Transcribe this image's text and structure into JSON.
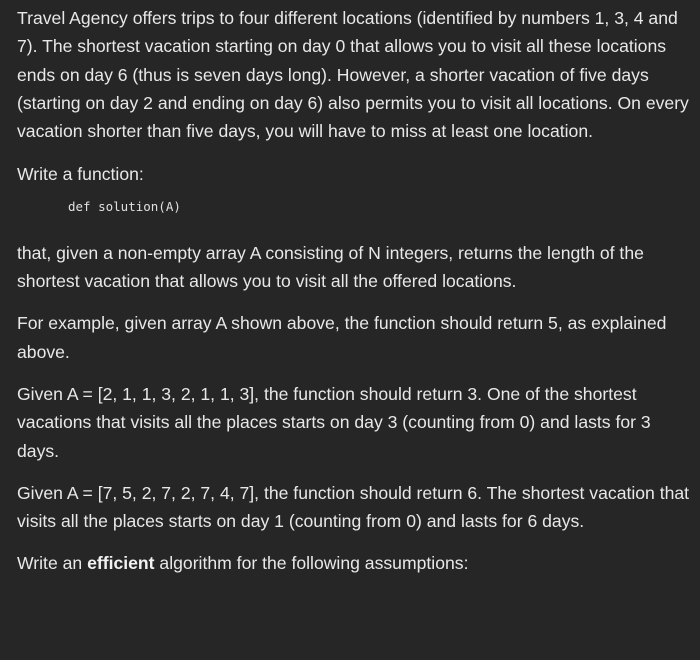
{
  "paragraphs": {
    "intro": "Travel Agency offers trips to four different locations (identified by numbers 1, 3, 4 and 7). The shortest vacation starting on day 0 that allows you to visit all these locations ends on day 6 (thus is seven days long). However, a shorter vacation of five days (starting on day 2 and ending on day 6) also permits you to visit all locations. On every vacation shorter than five days, you will have to miss at least one location.",
    "write_function": "Write a function:",
    "code": "def solution(A)",
    "that_given": "that, given a non-empty array A consisting of N integers, returns the length of the shortest vacation that allows you to visit all the offered locations.",
    "example": "For example, given array A shown above, the function should return 5, as explained above.",
    "given_1": "Given A = [2, 1, 1, 3, 2, 1, 1, 3], the function should return 3. One of the shortest vacations that visits all the places starts on day 3 (counting from 0) and lasts for 3 days.",
    "given_2": "Given A = [7, 5, 2, 7, 2, 7, 4, 7], the function should return 6. The shortest vacation that visits all the places starts on day 1 (counting from 0) and lasts for 6 days.",
    "efficient_prefix": "Write an ",
    "efficient_bold": "efficient",
    "efficient_suffix": " algorithm for the following assumptions:"
  }
}
